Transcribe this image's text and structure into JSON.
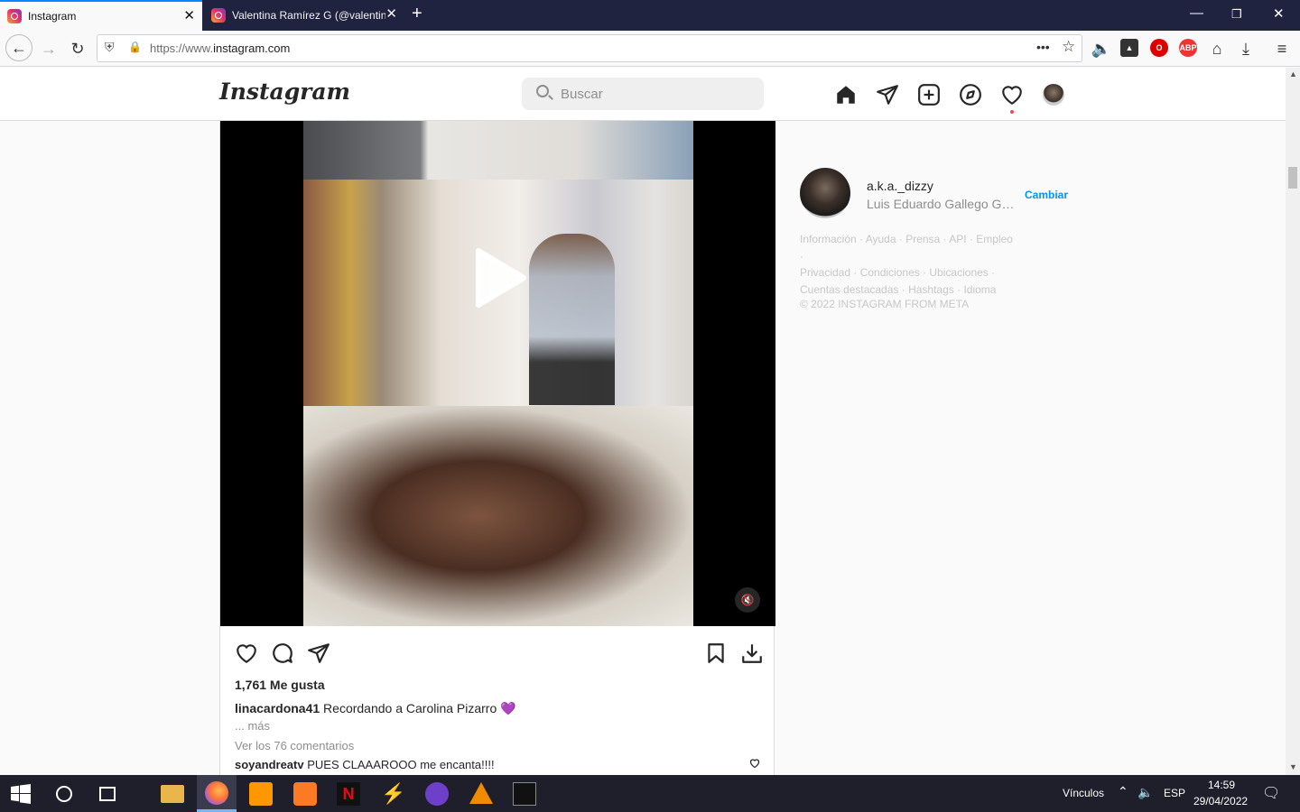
{
  "browser": {
    "tabs": [
      {
        "title": "Instagram",
        "active": true
      },
      {
        "title": "Valentina Ramírez G (@valentin",
        "active": false
      }
    ],
    "url_prefix": "https://www.",
    "url_domain": "instagram.com",
    "url_rest": "",
    "more_label": "•••"
  },
  "instagram": {
    "logo": "Instagram",
    "search_placeholder": "Buscar",
    "post": {
      "likes": "1,761 Me gusta",
      "caption_user": "linacardona41",
      "caption_text": "Recordando a Carolina Pizarro",
      "caption_emoji": "💜",
      "more": "... más",
      "view_comments": "Ver los 76 comentarios",
      "comment_user": "soyandreatv",
      "comment_text": "PUES CLAAAROOO me encanta!!!!"
    },
    "sidebar": {
      "username": "a.k.a._dizzy",
      "fullname": "Luis Eduardo Gallego Gar...",
      "switch_label": "Cambiar",
      "footer_links": [
        "Información",
        "Ayuda",
        "Prensa",
        "API",
        "Empleo",
        "Privacidad",
        "Condiciones",
        "Ubicaciones",
        "Cuentas destacadas",
        "Hashtags",
        "Idioma"
      ],
      "copyright": "© 2022 INSTAGRAM FROM META"
    }
  },
  "taskbar": {
    "links_label": "Vínculos",
    "lang": "ESP",
    "time": "14:59",
    "date": "29/04/2022"
  },
  "colors": {
    "accent_blue": "#0095f6",
    "tab_bar": "#202340",
    "taskbar": "#1e1f2b"
  }
}
